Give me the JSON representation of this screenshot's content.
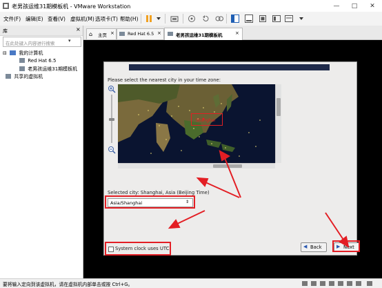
{
  "window": {
    "title": "老男孩运维31期模板机 - VMware Workstation"
  },
  "menu": [
    "文件(F)",
    "编辑(E)",
    "查看(V)",
    "虚拟机(M)",
    "选项卡(T)",
    "帮助(H)"
  ],
  "library": {
    "header": "库",
    "search_placeholder": "在此处键入内容进行搜索",
    "tree": {
      "root": "我的计算机",
      "vms": [
        "Red Hat 6.5",
        "老男孩运维31期模板机"
      ],
      "shared": "共享的虚拟机"
    }
  },
  "tabs": [
    {
      "label": "主页"
    },
    {
      "label": "Red Hat 6.5"
    },
    {
      "label": "老男孩运维31期模板机",
      "active": true
    }
  ],
  "installer": {
    "prompt": "Please select the nearest city in your time zone:",
    "map_city_label": "Shanghai",
    "selected_city": "Selected city: Shanghai, Asia (Beijing Time)",
    "timezone_value": "Asia/Shanghai",
    "utc_label": "System clock uses UTC",
    "utc_checked": false,
    "back_label": "Back",
    "next_label": "Next"
  },
  "status_bar": {
    "text": "要将输入定向到该虚拟机，请在虚拟机内部单击或按 Ctrl+G。"
  },
  "colors": {
    "annotation_red": "#e31e24",
    "vm_background": "#000000",
    "installer_bg": "#edeceb"
  },
  "icons": [
    "vm-app-icon",
    "pause-icon",
    "send-keys-icon",
    "snapshot-icon",
    "revert-icon",
    "manage-snapshots-icon",
    "library-view-icon",
    "thumbnail-view-icon",
    "fullscreen-icon",
    "unity-icon",
    "console-view-icon",
    "zoom-in-icon",
    "zoom-out-icon",
    "back-arrow-icon",
    "next-arrow-icon"
  ]
}
